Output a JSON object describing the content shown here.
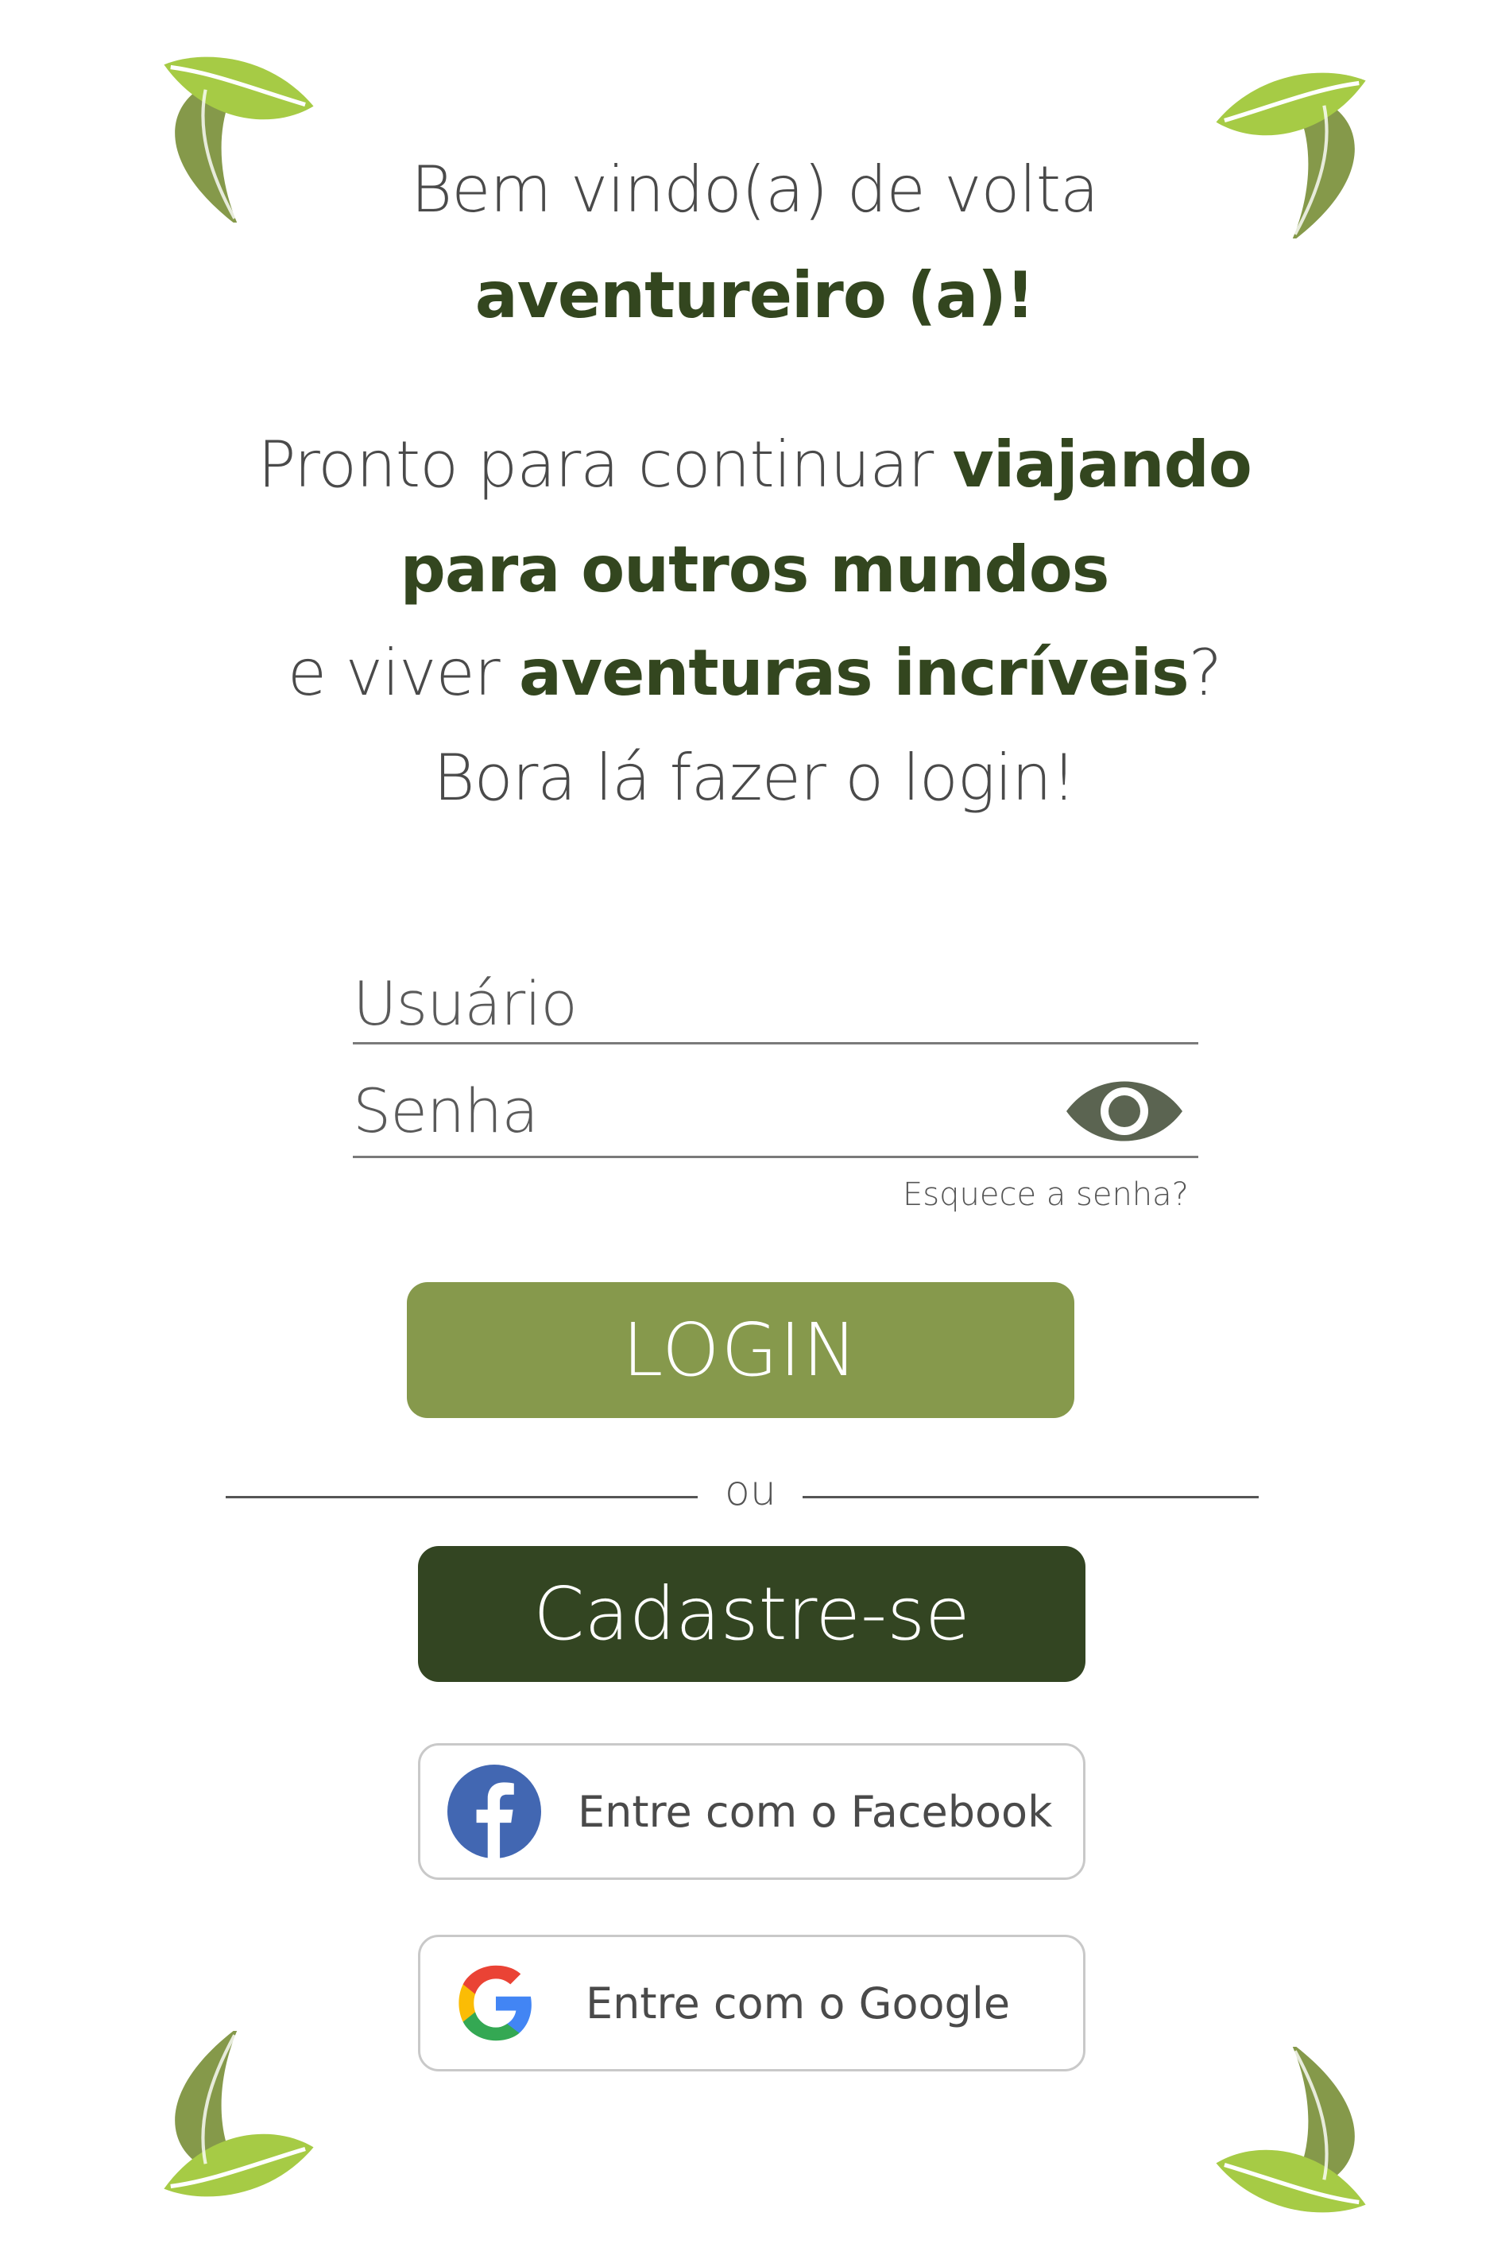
{
  "welcome": {
    "line1": "Bem vindo(a) de volta",
    "line2": "aventureiro (a)!"
  },
  "intro": {
    "line1_plain": "Pronto para continuar ",
    "line1_bold": "viajando",
    "line2_bold": "para outros mundos",
    "line3_plain": "e viver ",
    "line3_bold": "aventuras incríveis",
    "line3_end": "?",
    "line4": "Bora lá fazer o login!"
  },
  "form": {
    "username_placeholder": "Usuário",
    "password_placeholder": "Senha",
    "forgot_password": "Esquece a senha?",
    "login_label": "LOGIN"
  },
  "divider": {
    "text": "ou"
  },
  "register": {
    "label": "Cadastre-se"
  },
  "social": {
    "facebook_label": "Entre com o Facebook",
    "google_label": "Entre com o Google"
  },
  "colors": {
    "dark_green": "#334522",
    "olive_green": "#86994c",
    "leaf_light": "#a6cb45",
    "leaf_dark": "#85994a",
    "facebook_blue": "#4267b2"
  },
  "icons": {
    "eye": "eye-icon",
    "facebook": "facebook-icon",
    "google": "google-icon",
    "leaf": "leaf-icon"
  }
}
